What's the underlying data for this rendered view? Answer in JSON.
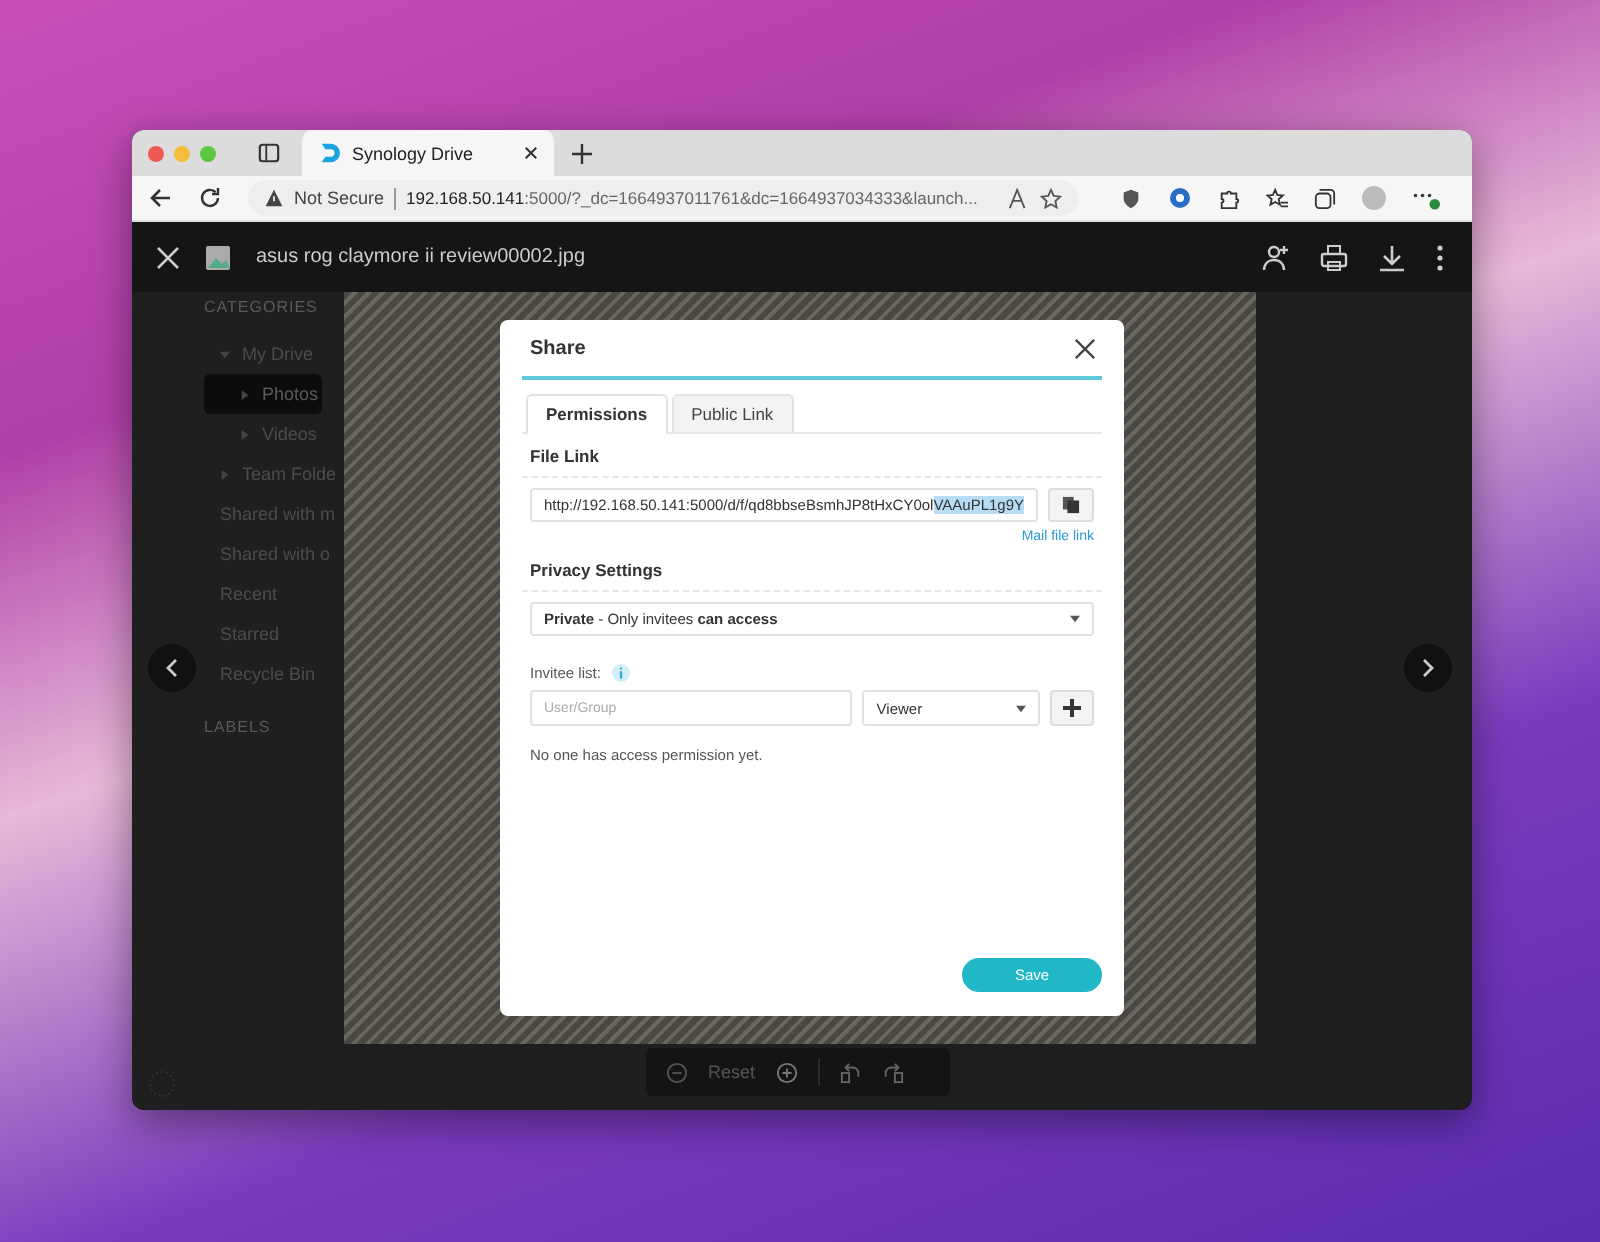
{
  "browser": {
    "tab_title": "Synology Drive",
    "security": "Not Secure",
    "url_host": "192.168.50.141",
    "url_rest": ":5000/?_dc=1664937011761&dc=1664937034333&launch..."
  },
  "viewer": {
    "file_name": "asus rog claymore ii review00002.jpg",
    "zoom_reset": "Reset"
  },
  "sidebar": {
    "heading": "CATEGORIES",
    "items": [
      {
        "label": "My Drive",
        "expanded": true,
        "selected": false,
        "children": [
          {
            "label": "Photos",
            "expanded": false,
            "selected": true
          },
          {
            "label": "Videos",
            "expanded": false,
            "selected": false
          }
        ]
      },
      {
        "label": "Team Folde",
        "expanded": false,
        "selected": false
      },
      {
        "label": "Shared with m",
        "selected": false
      },
      {
        "label": "Shared with o",
        "selected": false
      },
      {
        "label": "Recent",
        "selected": false
      },
      {
        "label": "Starred",
        "selected": false
      },
      {
        "label": "Recycle Bin",
        "selected": false
      }
    ],
    "footer_heading": "LABELS"
  },
  "share_dialog": {
    "title": "Share",
    "tabs": [
      {
        "label": "Permissions",
        "selected": true
      },
      {
        "label": "Public Link",
        "selected": false
      }
    ],
    "file_link_heading": "File Link",
    "link_url": "http://192.168.50.141:5000/d/f/qd8bbseBsmhJP8tHxCY0ol",
    "link_selected_part": "VAAuPL1g9Y",
    "mail_link": "Mail file link",
    "privacy_heading": "Privacy Settings",
    "privacy_value": "**Private** - Only invitees **can access**",
    "invitee_label": "Invitee list:",
    "invitee_placeholder": "User/Group",
    "role": "Viewer",
    "empty_note": "No one has access permission yet.",
    "save": "Save"
  }
}
